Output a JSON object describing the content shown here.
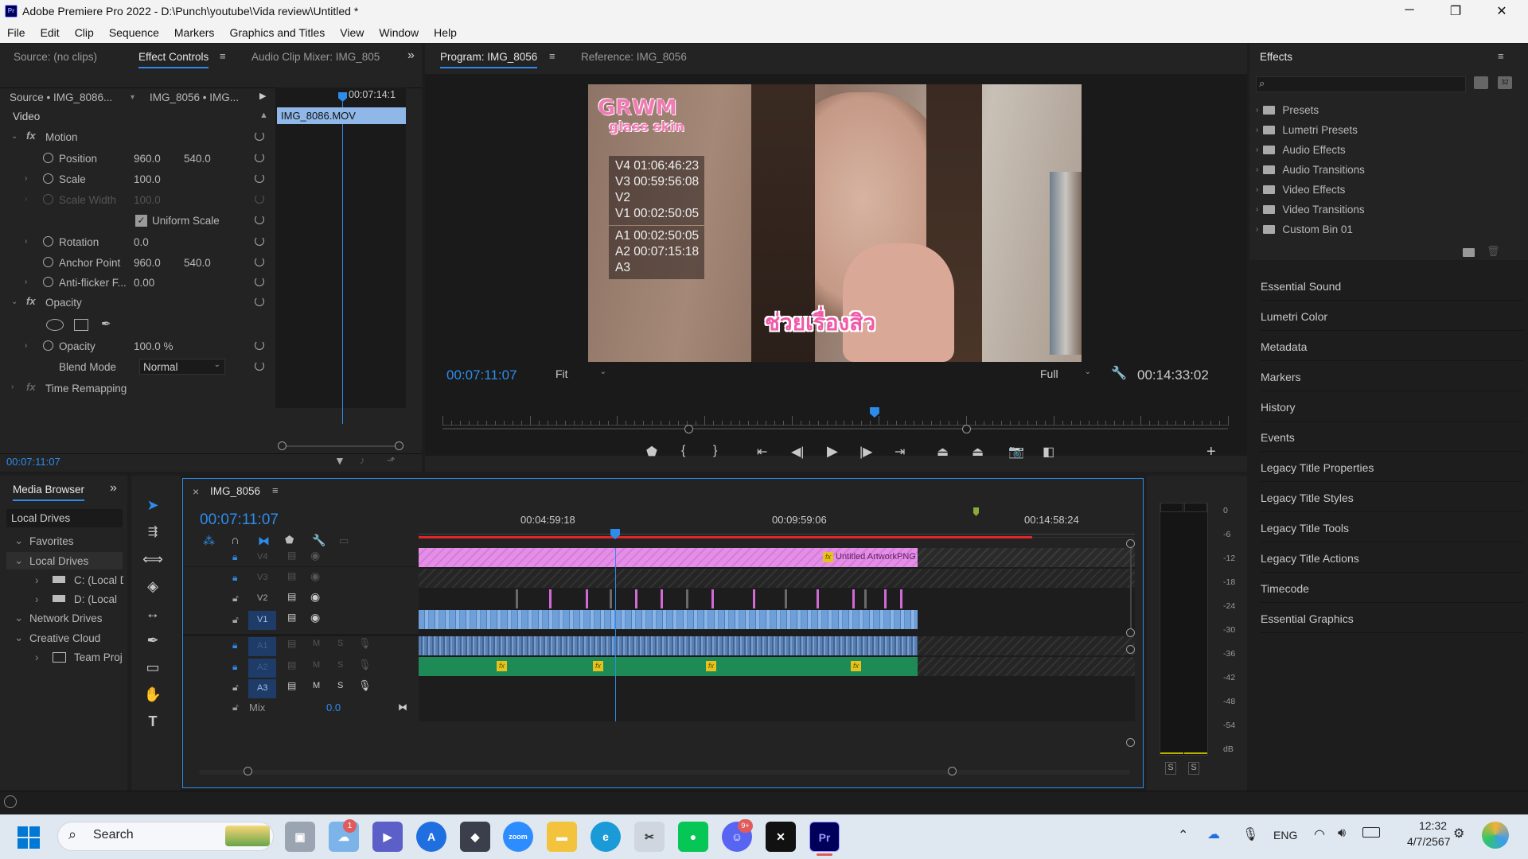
{
  "window": {
    "title": "Adobe Premiere Pro 2022 - D:\\Punch\\youtube\\Vida review\\Untitled *",
    "app_icon": "Pr",
    "minimize": "─",
    "maximize": "❐",
    "close": "✕"
  },
  "menu": [
    "File",
    "Edit",
    "Clip",
    "Sequence",
    "Markers",
    "Graphics and Titles",
    "View",
    "Window",
    "Help"
  ],
  "source_panel": {
    "tabs": {
      "source": "Source: (no clips)",
      "effect_controls": "Effect Controls",
      "audio_mixer": "Audio Clip Mixer: IMG_805"
    },
    "source_clip": "Source • IMG_8086...",
    "sequence_clip": "IMG_8056 • IMG...",
    "timecode_top": "00:07:14:1",
    "clip_bar": "IMG_8086.MOV",
    "video_label": "Video",
    "motion": "Motion",
    "position_label": "Position",
    "position_x": "960.0",
    "position_y": "540.0",
    "scale_label": "Scale",
    "scale": "100.0",
    "scale_width_label": "Scale Width",
    "scale_width": "100.0",
    "uniform_scale": "Uniform Scale",
    "rotation_label": "Rotation",
    "rotation": "0.0",
    "anchor_label": "Anchor Point",
    "anchor_x": "960.0",
    "anchor_y": "540.0",
    "antiflicker_label": "Anti-flicker F...",
    "antiflicker": "0.00",
    "opacity_section": "Opacity",
    "opacity_label": "Opacity",
    "opacity": "100.0 %",
    "blend_label": "Blend Mode",
    "blend": "Normal",
    "time_remap": "Time Remapping",
    "fx": "fx",
    "timecode_bottom": "00:07:11:07"
  },
  "program": {
    "tabs": {
      "program": "Program: IMG_8056",
      "reference": "Reference: IMG_8056"
    },
    "overlay_title_1": "GRWM",
    "overlay_title_2": "glass skin",
    "overlay_info": [
      "V4 01:06:46:23",
      "V3 00:59:56:08",
      "V2",
      "V1 00:02:50:05"
    ],
    "overlay_audio": [
      "A1 00:02:50:05",
      "A2 00:07:15:18",
      "A3"
    ],
    "caption": "ช่วยเรื่องสิว",
    "timecode": "00:07:11:07",
    "fit": "Fit",
    "quality": "Full",
    "duration": "00:14:33:02",
    "playhead_fraction": 0.55
  },
  "effects": {
    "title": "Effects",
    "items": [
      "Presets",
      "Lumetri Presets",
      "Audio Effects",
      "Audio Transitions",
      "Video Effects",
      "Video Transitions",
      "Custom Bin 01"
    ],
    "panels": [
      "Essential Sound",
      "Lumetri Color",
      "Metadata",
      "Markers",
      "History",
      "Events",
      "Legacy Title Properties",
      "Legacy Title Styles",
      "Legacy Title Tools",
      "Legacy Title Actions",
      "Timecode",
      "Essential Graphics"
    ]
  },
  "media_browser": {
    "tab": "Media Browser",
    "header": "Local Drives",
    "favorites": "Favorites",
    "local_drives": "Local Drives",
    "c_drive": "C: (Local D",
    "d_drive": "D: (Local",
    "network": "Network Drives",
    "creative_cloud": "Creative Cloud",
    "team": "Team Proj"
  },
  "timeline": {
    "tab": "IMG_8056",
    "close": "×",
    "timecode": "00:07:11:07",
    "ruler": [
      "00:04:59:18",
      "00:09:59:06",
      "00:14:58:24"
    ],
    "tracks_video": [
      "V4",
      "V3",
      "V2",
      "V1"
    ],
    "tracks_audio": [
      "A1",
      "A2",
      "A3"
    ],
    "mix_label": "Mix",
    "mix_value": "0.0",
    "v4_clip": "Untitled ArtworkPNG",
    "fx_badge": "fx",
    "m": "M",
    "s": "S"
  },
  "meters": {
    "scale": [
      "0",
      "-6",
      "-12",
      "-18",
      "-24",
      "-30",
      "-36",
      "-42",
      "-48",
      "-54",
      "dB"
    ],
    "solo": [
      "S",
      "S"
    ]
  },
  "taskbar": {
    "search": "Search",
    "lang": "ENG",
    "time": "12:32",
    "date": "4/7/2567",
    "badge_weather": "1",
    "badge_discord": "9+",
    "zoom": "zoom",
    "pr": "Pr"
  },
  "colors": {
    "accent": "#2d8ceb",
    "pink_clip": "#e58ee8",
    "v1_clip": "#6f9fd8",
    "audio_clip": "#1e8b57",
    "playhead": "#2d8ceb"
  }
}
